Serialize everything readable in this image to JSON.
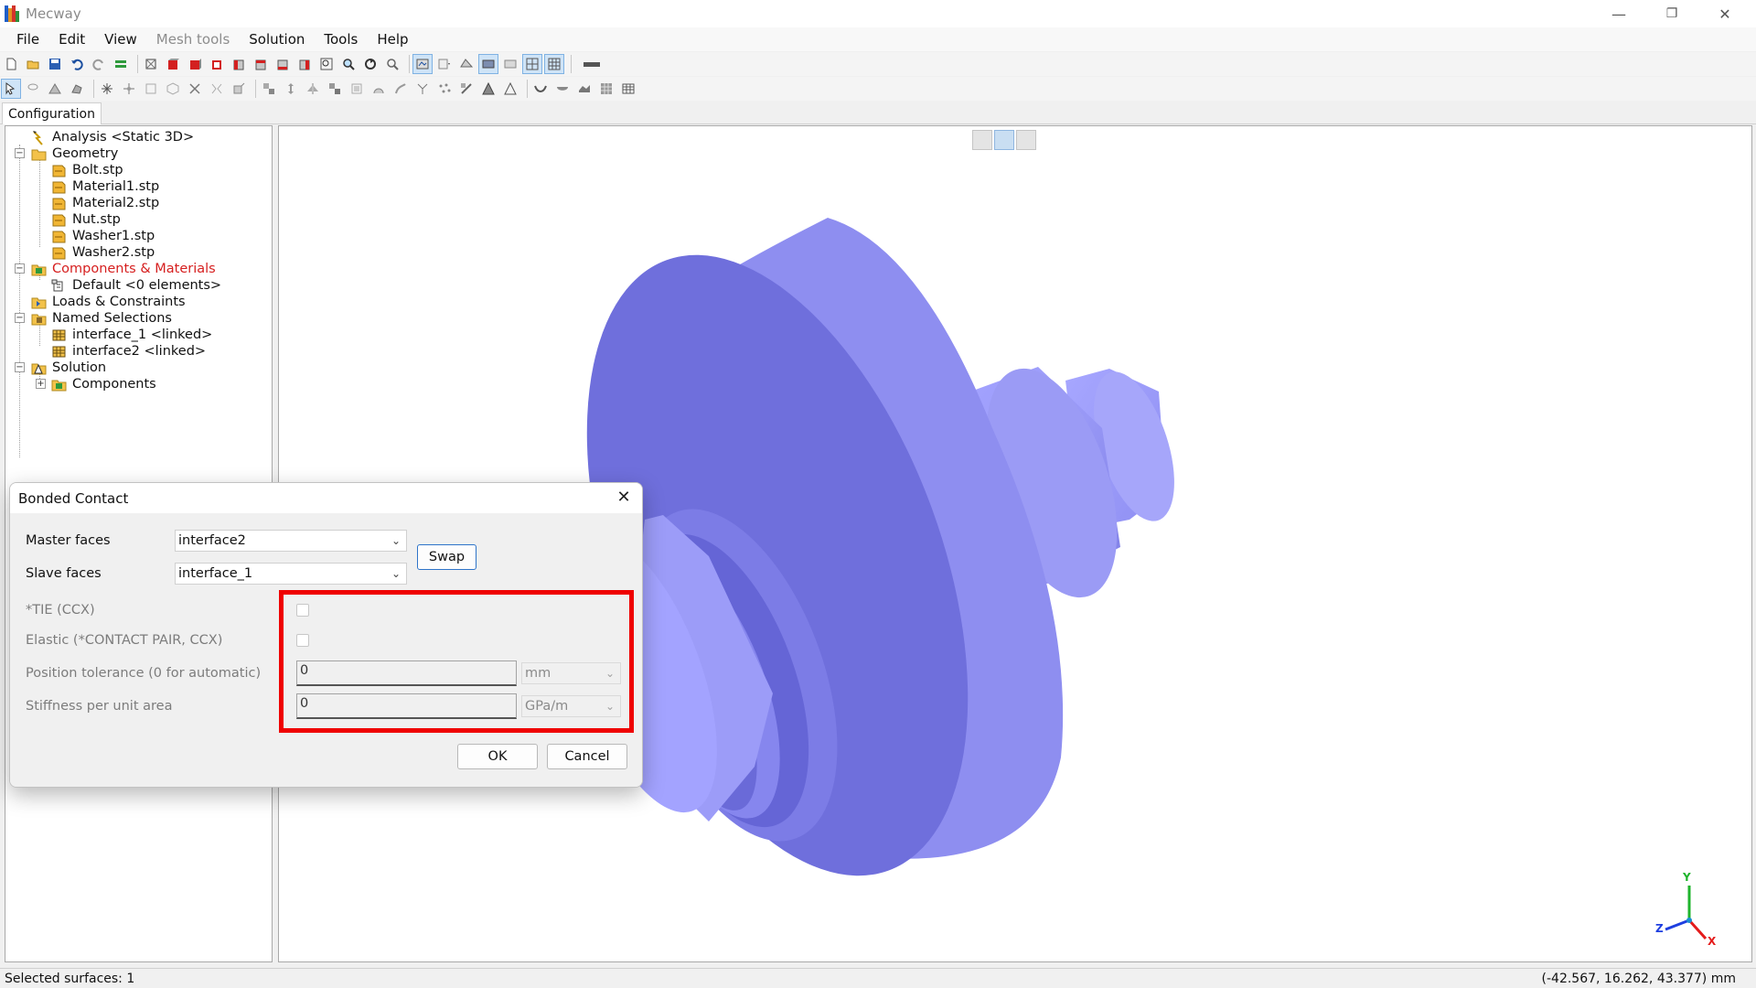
{
  "window": {
    "title": "Mecway",
    "controls": {
      "minimize": "—",
      "restore": "❐",
      "close": "✕"
    }
  },
  "menu": [
    {
      "label": "File",
      "enabled": true
    },
    {
      "label": "Edit",
      "enabled": true
    },
    {
      "label": "View",
      "enabled": true
    },
    {
      "label": "Mesh tools",
      "enabled": false
    },
    {
      "label": "Solution",
      "enabled": true
    },
    {
      "label": "Tools",
      "enabled": true
    },
    {
      "label": "Help",
      "enabled": true
    }
  ],
  "panel_tab": "Configuration",
  "tree": {
    "analysis": "Analysis <Static 3D>",
    "geometry": "Geometry",
    "geometry_items": [
      "Bolt.stp",
      "Material1.stp",
      "Material2.stp",
      "Nut.stp",
      "Washer1.stp",
      "Washer2.stp"
    ],
    "components_materials": "Components & Materials",
    "default_component": "Default <0 elements>",
    "loads_constraints": "Loads & Constraints",
    "named_selections": "Named Selections",
    "named_items": [
      "interface_1 <linked>",
      "interface2 <linked>"
    ],
    "solution": "Solution",
    "solution_components": "Components"
  },
  "dialog": {
    "title": "Bonded Contact",
    "close": "✕",
    "master_faces_label": "Master faces",
    "master_faces_value": "interface2",
    "slave_faces_label": "Slave faces",
    "slave_faces_value": "interface_1",
    "swap_label": "Swap",
    "tie_label": "*TIE (CCX)",
    "tie_checked": false,
    "elastic_label": "Elastic (*CONTACT PAIR, CCX)",
    "elastic_checked": false,
    "position_tolerance_label": "Position tolerance (0 for automatic)",
    "position_tolerance_value": "0",
    "position_tolerance_unit": "mm",
    "stiffness_label": "Stiffness per unit area",
    "stiffness_value": "0",
    "stiffness_unit": "GPa/m",
    "ok_label": "OK",
    "cancel_label": "Cancel"
  },
  "viewport": {
    "model_color": "#8f8ff2",
    "axis": {
      "x": "X",
      "y": "Y",
      "z": "Z"
    }
  },
  "status": {
    "left": "Selected surfaces: 1",
    "right": "(-42.567, 16.262, 43.377) mm"
  },
  "colors": {
    "highlight": "#ef0000",
    "red_tree_label": "#d61f1f"
  }
}
